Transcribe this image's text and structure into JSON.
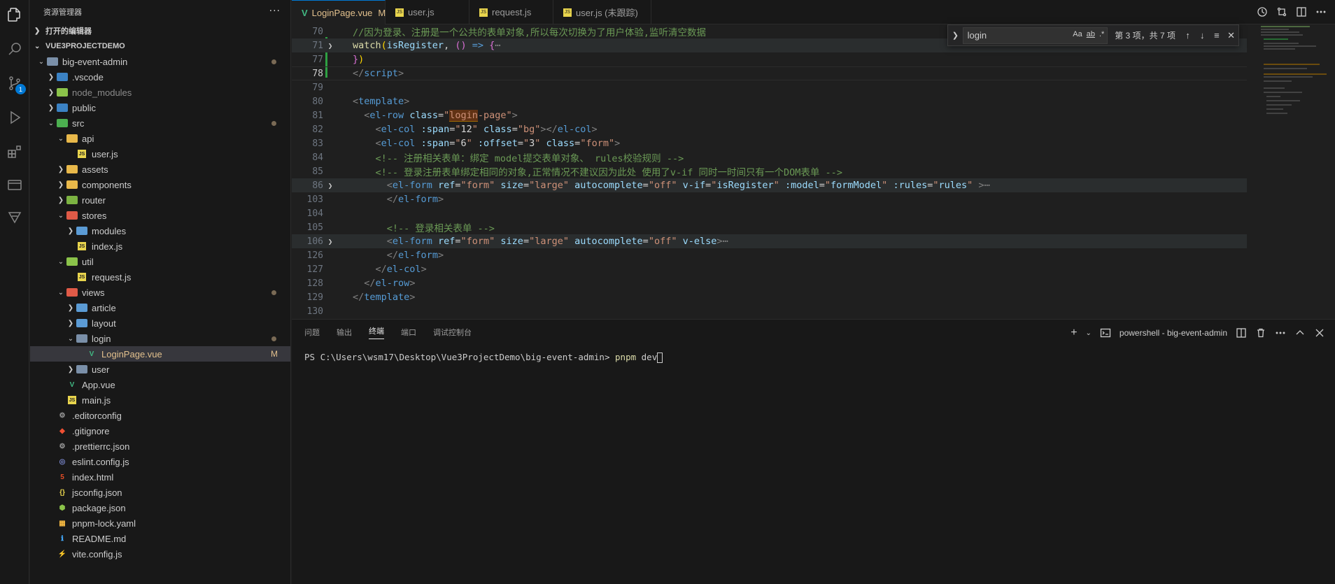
{
  "sidebar": {
    "title": "资源管理器",
    "more": "···",
    "open_editors": "打开的编辑器",
    "project": "VUE3PROJECTDEMO",
    "tree": [
      {
        "label": "big-event-admin",
        "type": "folder",
        "open": true
      },
      {
        "label": ".vscode",
        "type": "folder"
      },
      {
        "label": "node_modules",
        "type": "folder"
      },
      {
        "label": "public",
        "type": "folder"
      },
      {
        "label": "src",
        "type": "folder",
        "open": true
      },
      {
        "label": "api",
        "type": "folder",
        "open": true
      },
      {
        "label": "user.js",
        "type": "js"
      },
      {
        "label": "assets",
        "type": "folder"
      },
      {
        "label": "components",
        "type": "folder"
      },
      {
        "label": "router",
        "type": "folder"
      },
      {
        "label": "stores",
        "type": "folder",
        "open": true
      },
      {
        "label": "modules",
        "type": "folder"
      },
      {
        "label": "index.js",
        "type": "js"
      },
      {
        "label": "util",
        "type": "folder",
        "open": true
      },
      {
        "label": "request.js",
        "type": "js"
      },
      {
        "label": "views",
        "type": "folder",
        "open": true
      },
      {
        "label": "article",
        "type": "folder"
      },
      {
        "label": "layout",
        "type": "folder"
      },
      {
        "label": "login",
        "type": "folder",
        "open": true
      },
      {
        "label": "LoginPage.vue",
        "type": "vue",
        "badge": "M"
      },
      {
        "label": "user",
        "type": "folder"
      },
      {
        "label": "App.vue",
        "type": "vue"
      },
      {
        "label": "main.js",
        "type": "js"
      },
      {
        "label": ".editorconfig",
        "type": "cfg"
      },
      {
        "label": ".gitignore",
        "type": "git"
      },
      {
        "label": ".prettierrc.json",
        "type": "cfg"
      },
      {
        "label": "eslint.config.js",
        "type": "eslint"
      },
      {
        "label": "index.html",
        "type": "html"
      },
      {
        "label": "jsconfig.json",
        "type": "json"
      },
      {
        "label": "package.json",
        "type": "npm"
      },
      {
        "label": "pnpm-lock.yaml",
        "type": "yaml"
      },
      {
        "label": "README.md",
        "type": "info"
      },
      {
        "label": "vite.config.js",
        "type": "vite"
      }
    ]
  },
  "tabs": [
    {
      "label": "LoginPage.vue",
      "badge": "M",
      "active": true
    },
    {
      "label": "user.js"
    },
    {
      "label": "request.js"
    },
    {
      "label": "user.js (未跟踪)"
    }
  ],
  "find": {
    "query": "login",
    "opt_case": "Aa",
    "opt_word": "ab",
    "opt_regex": ".*",
    "count": "第 3 项，共 7 项"
  },
  "editor": {
    "line_numbers": [
      "70",
      "71",
      "77",
      "78",
      "79",
      "80",
      "81",
      "82",
      "83",
      "84",
      "85",
      "86",
      "103",
      "104",
      "105",
      "106",
      "126",
      "127",
      "128",
      "129",
      "130"
    ]
  },
  "panel": {
    "tabs": [
      "问题",
      "输出",
      "终端",
      "端口",
      "调试控制台"
    ],
    "active_tab": "终端",
    "terminal_name": "powershell - big-event-admin",
    "prompt": "PS C:\\Users\\wsm17\\Desktop\\Vue3ProjectDemo\\big-event-admin> ",
    "command": "pnpm",
    "arg": " dev"
  },
  "colors": {
    "accent": "#0078d4",
    "modified": "#e2c08d",
    "added_bar": "#2ea043"
  }
}
